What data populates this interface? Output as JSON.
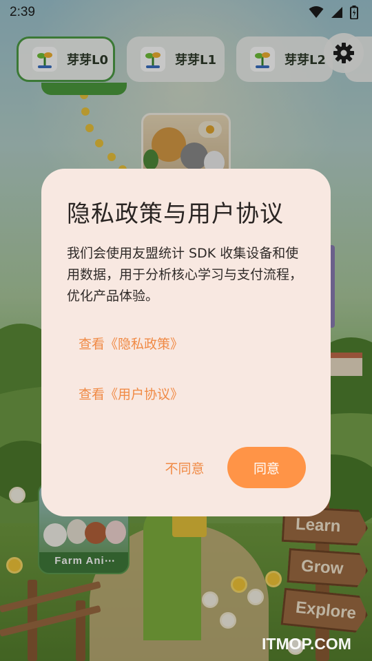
{
  "status_bar": {
    "time": "2:39",
    "icons": [
      "wifi-icon",
      "signal-icon",
      "battery-icon"
    ]
  },
  "level_tabs": [
    {
      "label": "芽芽L0",
      "active": true
    },
    {
      "label": "芽芽L1",
      "active": false
    },
    {
      "label": "芽芽L2",
      "active": false
    }
  ],
  "settings": {
    "icon": "gear-icon"
  },
  "background": {
    "farm_card_label": "Farm Ani⋯",
    "signs": [
      "Learn",
      "Grow",
      "Explore"
    ]
  },
  "dialog": {
    "title": "隐私政策与用户协议",
    "body": "我们会使用友盟统计 SDK 收集设备和使用数据，用于分析核心学习与支付流程，优化产品体验。",
    "privacy_link": "查看《隐私政策》",
    "terms_link": "查看《用户协议》",
    "disagree_label": "不同意",
    "agree_label": "同意"
  },
  "watermark": "ITMOP.COM",
  "colors": {
    "accent": "#ff9447",
    "link": "#f08a45",
    "dialog_bg": "#f8e8e1",
    "active_tab_border": "#4c9b45"
  }
}
